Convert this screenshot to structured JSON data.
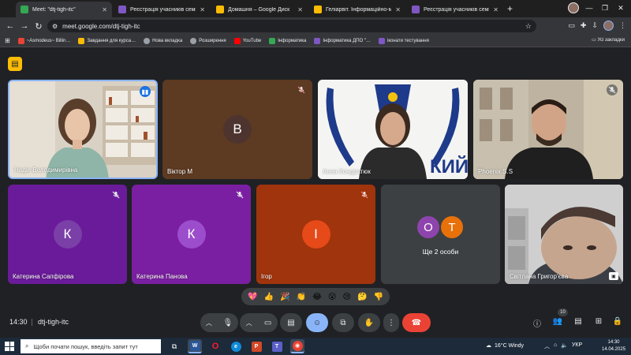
{
  "browser": {
    "tabs": [
      {
        "label": "Meet: \"dtj-tigh-itc\"",
        "active": true,
        "favicon_color": "#34a853"
      },
      {
        "label": "Реєстрація учасників семінару",
        "active": false,
        "favicon_color": "#7e57c2"
      },
      {
        "label": "Домашня – Google Диск",
        "active": false,
        "favicon_color": "#fbbc04"
      },
      {
        "label": "Геліарвіт. Інформаційно-мон…",
        "active": false,
        "favicon_color": "#fbbc04"
      },
      {
        "label": "Реєстрація учасників семінару",
        "active": false,
        "favicon_color": "#7e57c2"
      }
    ],
    "new_tab": "+",
    "url": "meet.google.com/dtj-tigh-itc",
    "bookmarks": [
      {
        "label": "~Asmodeus~ Billin…",
        "color": "#ea4335"
      },
      {
        "label": "Завдання для курса…",
        "color": "#fbbc04"
      },
      {
        "label": "Нова вкладка",
        "color": "#9aa0a6"
      },
      {
        "label": "Розширення",
        "color": "#9aa0a6"
      },
      {
        "label": "YouTube",
        "color": "#ff0000"
      },
      {
        "label": "Інформатика",
        "color": "#34a853"
      },
      {
        "label": "Інформатика ДПО \"…",
        "color": "#7e57c2"
      },
      {
        "label": "іконати тестування",
        "color": "#7e57c2"
      }
    ],
    "bookmarks_right": "Усі закладки"
  },
  "meet": {
    "tiles": [
      {
        "name": "Надія Володимирівна",
        "type": "video",
        "speaking": true
      },
      {
        "name": "Віктор М",
        "type": "avatar",
        "initial": "В",
        "muted": true,
        "bg": "#5d3a22",
        "avatar_bg": "#4e342e"
      },
      {
        "name": "Анна Кондратюк",
        "type": "video",
        "banner": "КИЙ"
      },
      {
        "name": "Phoenix S.S",
        "type": "video",
        "muted": true
      },
      {
        "name": "Катерина Сапфірова",
        "type": "avatar",
        "initial": "К",
        "muted": true,
        "bg": "#6a1b9a",
        "avatar_bg": "#7b3fa8"
      },
      {
        "name": "Катерина Панова",
        "type": "avatar",
        "initial": "К",
        "muted": true,
        "bg": "#7b1fa2",
        "avatar_bg": "#9c4dcc"
      },
      {
        "name": "Ігор",
        "type": "avatar",
        "initial": "І",
        "muted": true,
        "bg": "#a0340c",
        "avatar_bg": "#e64a19"
      },
      {
        "name": "Ще 2 особи",
        "type": "group",
        "initials": [
          "О",
          "Т"
        ],
        "colors": [
          "#8e44ad",
          "#e8710a"
        ]
      },
      {
        "name": "Світлана Григор'єва",
        "type": "video"
      }
    ],
    "reactions": [
      "💖",
      "👍",
      "🎉",
      "👏",
      "😂",
      "😮",
      "😢",
      "🤔",
      "👎"
    ],
    "time": "14:30",
    "meeting_code": "dtj-tigh-itc",
    "participants_count": "10"
  },
  "taskbar": {
    "search_placeholder": "Щоби почати пошук, введіть запит тут",
    "weather": "16°C  Windy",
    "lang": "УКР",
    "clock_time": "14:30",
    "clock_date": "14.04.2025"
  }
}
